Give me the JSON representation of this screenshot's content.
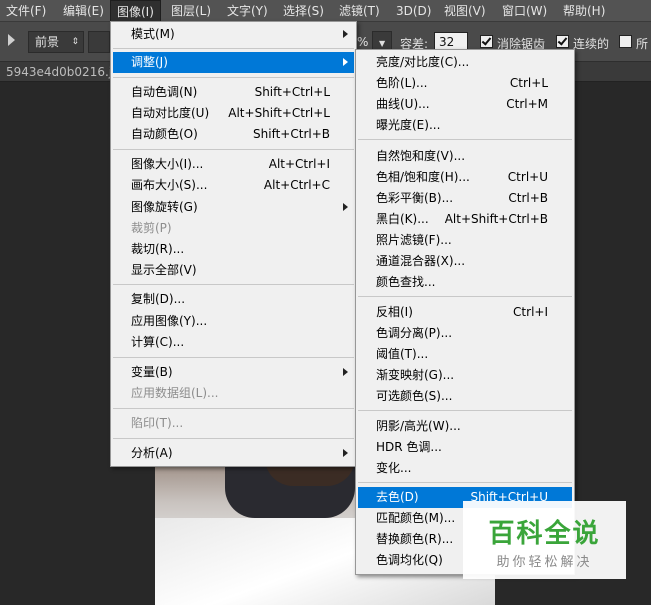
{
  "menubar": {
    "items": [
      "文件(F)",
      "编辑(E)",
      "图像(I)",
      "图层(L)",
      "文字(Y)",
      "选择(S)",
      "滤镜(T)",
      "3D(D)",
      "视图(V)",
      "窗口(W)",
      "帮助(H)"
    ]
  },
  "options": {
    "mode_select": "前景",
    "percent_tail": "%",
    "tolerance_label": "容差:",
    "tolerance_value": "32",
    "antialias_label": "消除锯齿",
    "contiguous_label": "连续的",
    "all_layers_label": "所"
  },
  "document": {
    "tab_label": "5943e4d0b0216.jp"
  },
  "image_menu": {
    "items": [
      {
        "label": "模式(M)",
        "shortcut": ""
      },
      {
        "label": "调整(J)",
        "shortcut": ""
      },
      {
        "label": "自动色调(N)",
        "shortcut": "Shift+Ctrl+L"
      },
      {
        "label": "自动对比度(U)",
        "shortcut": "Alt+Shift+Ctrl+L"
      },
      {
        "label": "自动颜色(O)",
        "shortcut": "Shift+Ctrl+B"
      },
      {
        "label": "图像大小(I)...",
        "shortcut": "Alt+Ctrl+I"
      },
      {
        "label": "画布大小(S)...",
        "shortcut": "Alt+Ctrl+C"
      },
      {
        "label": "图像旋转(G)",
        "shortcut": ""
      },
      {
        "label": "裁剪(P)",
        "shortcut": ""
      },
      {
        "label": "裁切(R)...",
        "shortcut": ""
      },
      {
        "label": "显示全部(V)",
        "shortcut": ""
      },
      {
        "label": "复制(D)...",
        "shortcut": ""
      },
      {
        "label": "应用图像(Y)...",
        "shortcut": ""
      },
      {
        "label": "计算(C)...",
        "shortcut": ""
      },
      {
        "label": "变量(B)",
        "shortcut": ""
      },
      {
        "label": "应用数据组(L)...",
        "shortcut": ""
      },
      {
        "label": "陷印(T)...",
        "shortcut": ""
      },
      {
        "label": "分析(A)",
        "shortcut": ""
      }
    ]
  },
  "adjust_menu": {
    "items": [
      {
        "label": "亮度/对比度(C)...",
        "shortcut": ""
      },
      {
        "label": "色阶(L)...",
        "shortcut": "Ctrl+L"
      },
      {
        "label": "曲线(U)...",
        "shortcut": "Ctrl+M"
      },
      {
        "label": "曝光度(E)...",
        "shortcut": ""
      },
      {
        "label": "自然饱和度(V)...",
        "shortcut": ""
      },
      {
        "label": "色相/饱和度(H)...",
        "shortcut": "Ctrl+U"
      },
      {
        "label": "色彩平衡(B)...",
        "shortcut": "Ctrl+B"
      },
      {
        "label": "黑白(K)...",
        "shortcut": "Alt+Shift+Ctrl+B"
      },
      {
        "label": "照片滤镜(F)...",
        "shortcut": ""
      },
      {
        "label": "通道混合器(X)...",
        "shortcut": ""
      },
      {
        "label": "颜色查找...",
        "shortcut": ""
      },
      {
        "label": "反相(I)",
        "shortcut": "Ctrl+I"
      },
      {
        "label": "色调分离(P)...",
        "shortcut": ""
      },
      {
        "label": "阈值(T)...",
        "shortcut": ""
      },
      {
        "label": "渐变映射(G)...",
        "shortcut": ""
      },
      {
        "label": "可选颜色(S)...",
        "shortcut": ""
      },
      {
        "label": "阴影/高光(W)...",
        "shortcut": ""
      },
      {
        "label": "HDR 色调...",
        "shortcut": ""
      },
      {
        "label": "变化...",
        "shortcut": ""
      },
      {
        "label": "去色(D)",
        "shortcut": "Shift+Ctrl+U"
      },
      {
        "label": "匹配颜色(M)...",
        "shortcut": ""
      },
      {
        "label": "替换颜色(R)...",
        "shortcut": ""
      },
      {
        "label": "色调均化(Q)",
        "shortcut": ""
      }
    ]
  },
  "watermark": {
    "title": "百科全说",
    "subtitle": "助你轻松解决"
  },
  "colors": {
    "highlight": "#0078d7",
    "menu_bg": "#f0f0f0",
    "app_bg": "#282828",
    "watermark_green": "#3aa53a"
  }
}
